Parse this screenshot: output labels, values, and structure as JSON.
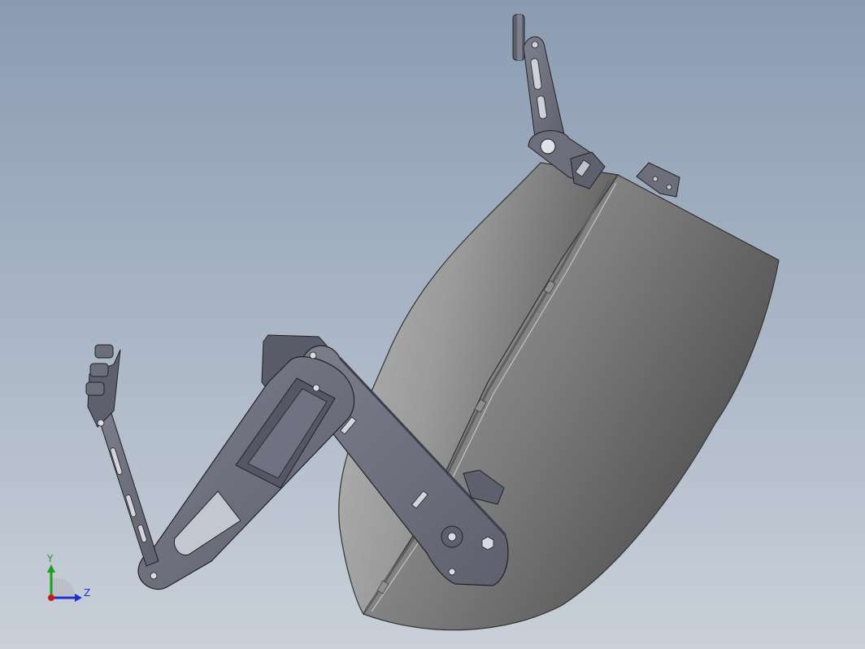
{
  "viewport": {
    "background_top": "#8a9bb2",
    "background_bottom": "#c8d0da"
  },
  "model": {
    "shell_color_light": "#a9a9a9",
    "shell_color_dark": "#5a5a5a",
    "part_color": "#6c6e7c",
    "part_color_dark": "#3d3f4c",
    "edge_color": "#222222"
  },
  "triad": {
    "y_label": "Y",
    "z_label": "Z",
    "y_color": "#1aa01a",
    "z_color": "#1c2fd0",
    "x_color": "#d01818"
  }
}
